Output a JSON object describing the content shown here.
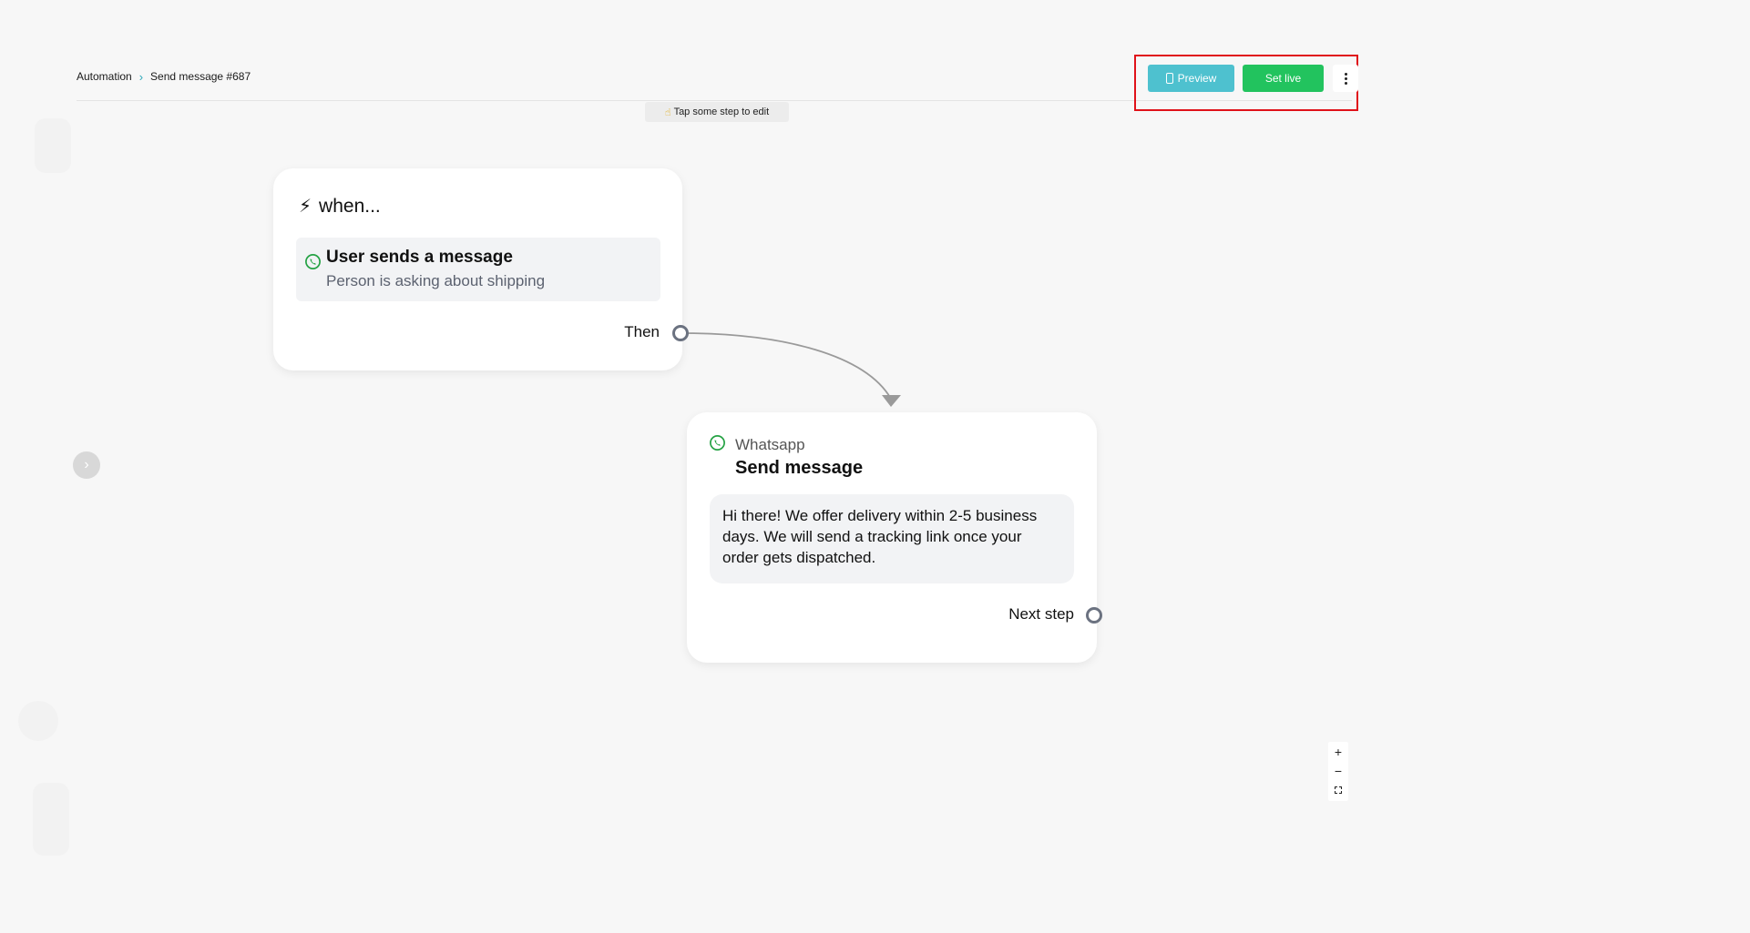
{
  "breadcrumb": {
    "root": "Automation",
    "separator": ">",
    "current": "Send message #687"
  },
  "hint": {
    "icon": "pointing-hand-icon",
    "text": "Tap some step to edit"
  },
  "toolbar": {
    "preview_label": "Preview",
    "set_live_label": "Set live",
    "preview_color": "#4ec1cf",
    "set_live_color": "#22c35e"
  },
  "trigger_card": {
    "title": "when...",
    "trigger_title": "User sends a message",
    "trigger_subtitle": "Person is asking about shipping",
    "output_label": "Then"
  },
  "action_card": {
    "channel": "Whatsapp",
    "title": "Send message",
    "message": "Hi there! We offer delivery within 2-5 business days. We will send a tracking link once your order gets dispatched.",
    "output_label": "Next step"
  },
  "zoom_controls": {
    "zoom_in": "+",
    "zoom_out": "−"
  },
  "colors": {
    "whatsapp": "#25a244",
    "highlight": "#e0121a"
  }
}
